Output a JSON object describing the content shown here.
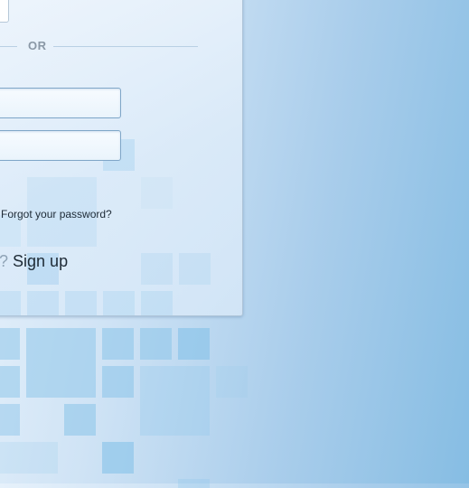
{
  "divider": {
    "text": "OR"
  },
  "login_form": {
    "username_value": "",
    "password_value": "",
    "forgot_password": "Forgot your password?"
  },
  "signup": {
    "prefix": "t?",
    "link": "Sign up"
  },
  "colors": {
    "panel_border": "#aec4d8",
    "field_border": "#7fa6c8",
    "tile": "#8fc6ea",
    "background_right": "#86bde3"
  }
}
